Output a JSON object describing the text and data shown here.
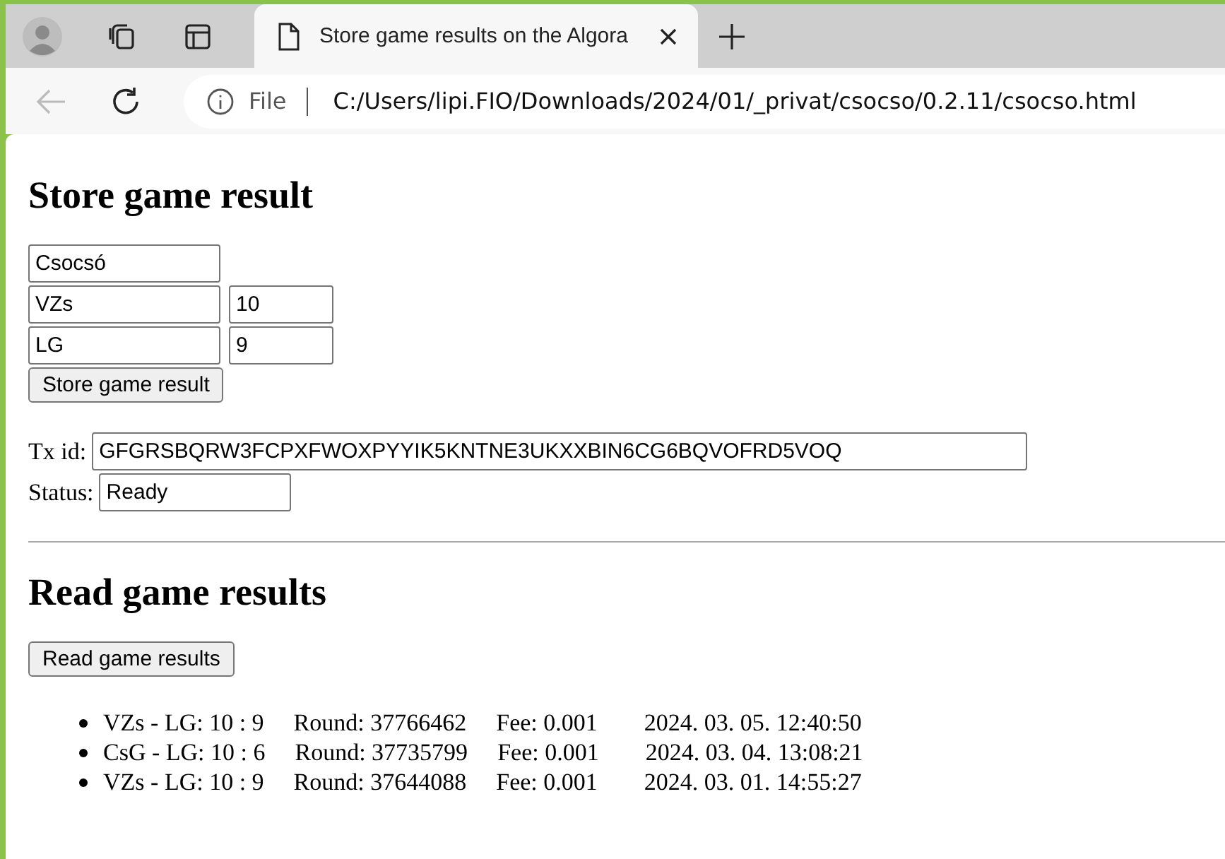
{
  "browser": {
    "tab": {
      "title": "Store game results on the Algora",
      "selected": true
    },
    "address": {
      "scheme": "File",
      "url": "C:/Users/lipi.FIO/Downloads/2024/01/_privat/csocso/0.2.11/csocso.html"
    }
  },
  "store": {
    "heading": "Store game result",
    "game": "Csocsó",
    "players": [
      {
        "name": "VZs",
        "score": "10"
      },
      {
        "name": "LG",
        "score": "9"
      }
    ],
    "button": "Store game result",
    "tx_label": "Tx id:",
    "tx_id": "GFGRSBQRW3FCPXFWOXPYYIK5KNTNE3UKXXBIN6CG6BQVOFRD5VOQ",
    "status_label": "Status:",
    "status": "Ready"
  },
  "read": {
    "heading": "Read game results",
    "button": "Read game results",
    "results": [
      {
        "match": "VZs - LG: 10 : 9",
        "round": "Round: 37766462",
        "fee": "Fee: 0.001",
        "date": "2024. 03. 05. 12:40:50"
      },
      {
        "match": "CsG - LG: 10 : 6",
        "round": "Round: 37735799",
        "fee": "Fee: 0.001",
        "date": "2024. 03. 04. 13:08:21"
      },
      {
        "match": "VZs - LG: 10 : 9",
        "round": "Round: 37644088",
        "fee": "Fee: 0.001",
        "date": "2024. 03. 01. 14:55:27"
      }
    ]
  }
}
